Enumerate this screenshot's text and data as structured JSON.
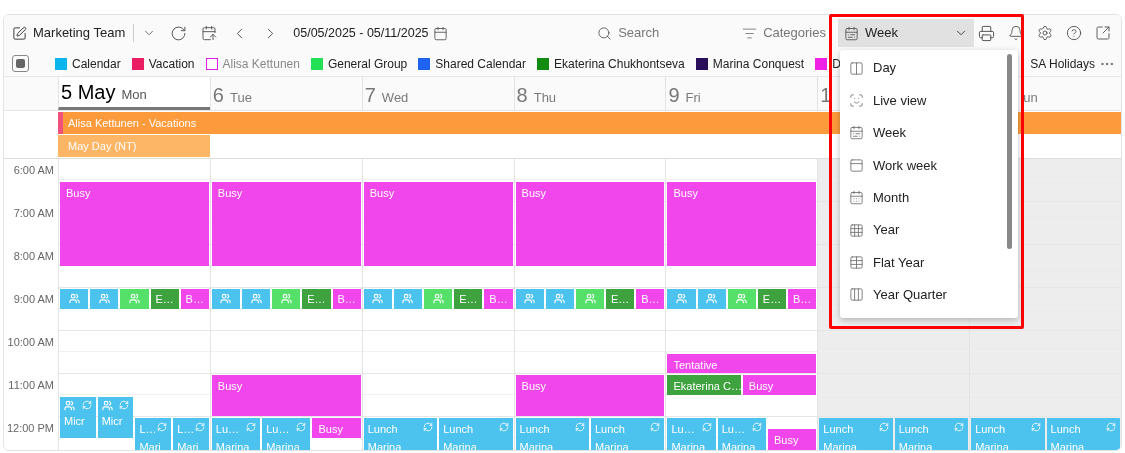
{
  "toolbar": {
    "calendar_name": "Marketing Team",
    "date_range": "05/05/2025 - 05/11/2025",
    "search": {
      "placeholder": "Search"
    },
    "categories": "Categories",
    "view": {
      "label": "Week",
      "open": true
    }
  },
  "legend": {
    "items": [
      {
        "label": "Calendar",
        "color": "#0ab4ec",
        "checked": true
      },
      {
        "label": "Vacation",
        "color": "#ea1f63",
        "checked": true
      },
      {
        "label": "Alisa Kettunen",
        "color": "#e020e0",
        "checked": false
      },
      {
        "label": "General Group",
        "color": "#22e055",
        "checked": true
      },
      {
        "label": "Shared Calendar",
        "color": "#1e63f0",
        "checked": true
      },
      {
        "label": "Ekaterina Chukhontseva",
        "color": "#118c11",
        "checked": true
      },
      {
        "label": "Marina Conquest",
        "color": "#2a0f5a",
        "checked": true
      },
      {
        "label": "D",
        "color": "#f020e6",
        "checked": true
      }
    ],
    "covered_item": {
      "label": "SA Holidays"
    }
  },
  "all_day": [
    {
      "title": "Alisa Kettunen - Vacations",
      "color": "#fd9b3c"
    },
    {
      "title": "May Day (NT)",
      "color": "#fdb566"
    }
  ],
  "times": [
    "6:00 AM",
    "7:00 AM",
    "8:00 AM",
    "9:00 AM",
    "10:00 AM",
    "11:00 AM",
    "12:00 PM"
  ],
  "days": [
    {
      "number": "5",
      "month": "May",
      "weekday": "Mon",
      "selected": true,
      "weekend": false,
      "events": [
        {
          "kind": "plain",
          "title": "Busy",
          "color": "#f046ec"
        },
        {
          "kind": "meeting",
          "color": "#4cc2ee"
        },
        {
          "kind": "meeting",
          "color": "#4cc2ee"
        },
        {
          "kind": "meeting",
          "color": "#55e06a"
        },
        {
          "kind": "short",
          "title": "E…",
          "color": "#3ea33e"
        },
        {
          "kind": "short",
          "title": "B…",
          "color": "#f046ec"
        },
        {
          "kind": "meeting_series",
          "title": "Micr",
          "color": "#4cc2ee"
        },
        {
          "kind": "meeting_series",
          "title": "Micr",
          "color": "#4cc2ee"
        },
        {
          "kind": "series",
          "title": "L…",
          "subtitle": "Mari",
          "color": "#4cc2ee"
        },
        {
          "kind": "series",
          "title": "L…",
          "subtitle": "Mari",
          "color": "#4cc2ee"
        }
      ]
    },
    {
      "number": "6",
      "weekday": "Tue",
      "selected": false,
      "weekend": false,
      "events": [
        {
          "kind": "plain",
          "title": "Busy",
          "color": "#f046ec"
        },
        {
          "kind": "meeting",
          "color": "#4cc2ee"
        },
        {
          "kind": "meeting",
          "color": "#4cc2ee"
        },
        {
          "kind": "meeting",
          "color": "#55e06a"
        },
        {
          "kind": "short",
          "title": "E…",
          "color": "#3ea33e"
        },
        {
          "kind": "short",
          "title": "B…",
          "color": "#f046ec"
        },
        {
          "kind": "plain",
          "title": "Busy",
          "color": "#f046ec"
        },
        {
          "kind": "series",
          "title": "Lu…",
          "subtitle": "Marina",
          "color": "#4cc2ee"
        },
        {
          "kind": "series",
          "title": "Lu…",
          "subtitle": "Marina",
          "color": "#4cc2ee"
        },
        {
          "kind": "plain",
          "title": "Busy",
          "color": "#f046ec"
        }
      ]
    },
    {
      "number": "7",
      "weekday": "Wed",
      "selected": false,
      "weekend": false,
      "events": [
        {
          "kind": "plain",
          "title": "Busy",
          "color": "#f046ec"
        },
        {
          "kind": "meeting",
          "color": "#4cc2ee"
        },
        {
          "kind": "meeting",
          "color": "#4cc2ee"
        },
        {
          "kind": "meeting",
          "color": "#55e06a"
        },
        {
          "kind": "short",
          "title": "E…",
          "color": "#3ea33e"
        },
        {
          "kind": "short",
          "title": "B…",
          "color": "#f046ec"
        },
        {
          "kind": "series",
          "title": "Lunch",
          "subtitle": "Marina",
          "color": "#4cc2ee"
        },
        {
          "kind": "series",
          "title": "Lunch",
          "subtitle": "Marina",
          "color": "#4cc2ee"
        }
      ]
    },
    {
      "number": "8",
      "weekday": "Thu",
      "selected": false,
      "weekend": false,
      "events": [
        {
          "kind": "plain",
          "title": "Busy",
          "color": "#f046ec"
        },
        {
          "kind": "meeting",
          "color": "#4cc2ee"
        },
        {
          "kind": "meeting",
          "color": "#4cc2ee"
        },
        {
          "kind": "meeting",
          "color": "#55e06a"
        },
        {
          "kind": "short",
          "title": "E…",
          "color": "#3ea33e"
        },
        {
          "kind": "short",
          "title": "B…",
          "color": "#f046ec"
        },
        {
          "kind": "plain",
          "title": "Busy",
          "color": "#f046ec"
        },
        {
          "kind": "series",
          "title": "Lunch",
          "subtitle": "Marina",
          "color": "#4cc2ee"
        },
        {
          "kind": "series",
          "title": "Lunch",
          "subtitle": "Marina",
          "color": "#4cc2ee"
        }
      ]
    },
    {
      "number": "9",
      "weekday": "Fri",
      "selected": false,
      "weekend": false,
      "events": [
        {
          "kind": "plain",
          "title": "Busy",
          "color": "#f046ec"
        },
        {
          "kind": "meeting",
          "color": "#4cc2ee"
        },
        {
          "kind": "meeting",
          "color": "#4cc2ee"
        },
        {
          "kind": "meeting",
          "color": "#55e06a"
        },
        {
          "kind": "short",
          "title": "E…",
          "color": "#3ea33e"
        },
        {
          "kind": "short",
          "title": "B…",
          "color": "#f046ec"
        },
        {
          "kind": "plain",
          "title": "Tentative",
          "color": "#f046ec"
        },
        {
          "kind": "plain",
          "title": "Ekaterina C…",
          "color": "#3ea33e"
        },
        {
          "kind": "plain",
          "title": "Busy",
          "color": "#f046ec"
        },
        {
          "kind": "series",
          "title": "Lu…",
          "subtitle": "Marina",
          "color": "#4cc2ee"
        },
        {
          "kind": "series",
          "title": "Lu…",
          "subtitle": "Marina",
          "color": "#4cc2ee"
        },
        {
          "kind": "plain",
          "title": "Busy",
          "color": "#f046ec"
        }
      ]
    },
    {
      "number": "1",
      "selected": false,
      "weekend": true,
      "events": [
        {
          "kind": "series",
          "title": "Lunch",
          "subtitle": "Marina",
          "color": "#4cc2ee"
        },
        {
          "kind": "series",
          "title": "Lunch",
          "subtitle": "Marina",
          "color": "#4cc2ee"
        }
      ]
    },
    {
      "weekday": "un",
      "selected": false,
      "weekend": true,
      "events": [
        {
          "kind": "series",
          "title": "Lunch",
          "subtitle": "Marina",
          "color": "#4cc2ee"
        },
        {
          "kind": "series",
          "title": "Lunch",
          "subtitle": "Marina",
          "color": "#4cc2ee"
        }
      ]
    }
  ],
  "view_menu": {
    "items": [
      {
        "label": "Day"
      },
      {
        "label": "Live view"
      },
      {
        "label": "Week"
      },
      {
        "label": "Work week"
      },
      {
        "label": "Month"
      },
      {
        "label": "Year"
      },
      {
        "label": "Flat Year"
      },
      {
        "label": "Year Quarter"
      }
    ]
  },
  "highlight": true
}
